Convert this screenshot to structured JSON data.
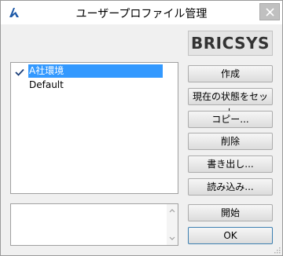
{
  "window": {
    "title": "ユーザープロファイル管理",
    "logo_text": "BRICSYS"
  },
  "profiles": {
    "items": [
      {
        "label": "A社環境",
        "checked": true,
        "selected": true
      },
      {
        "label": "Default",
        "checked": false,
        "selected": false
      }
    ]
  },
  "description": "",
  "buttons": {
    "create": "作成",
    "set_current": "現在の状態をセット",
    "copy": "コピー...",
    "delete": "削除",
    "export": "書き出し...",
    "import": "読み込み...",
    "start": "開始",
    "ok": "OK"
  },
  "colors": {
    "selection": "#3399ff",
    "close_button": "#c0c0c0",
    "app_icon": "#1e5aa8"
  }
}
